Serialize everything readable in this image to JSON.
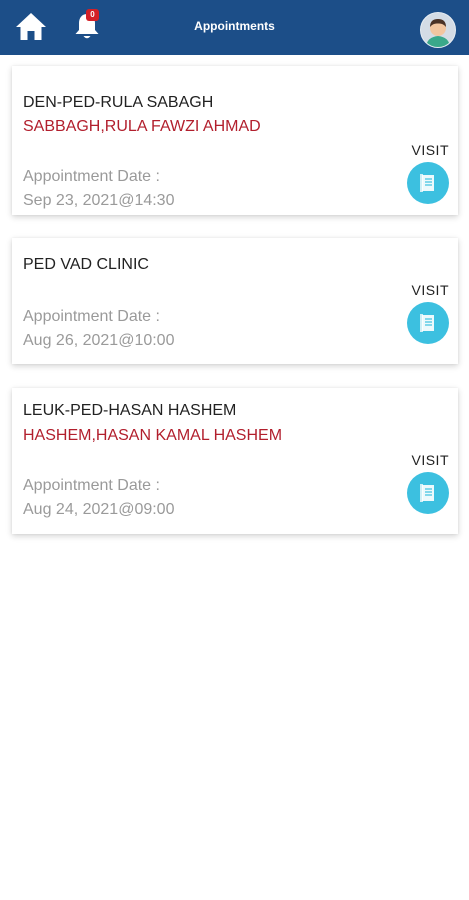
{
  "header": {
    "title": "Appointments",
    "notification_count": "0",
    "bar_color": "#1c4e88",
    "home_icon": "home-icon",
    "bell_icon": "bell-icon",
    "avatar_icon": "user-avatar"
  },
  "appointments": [
    {
      "clinic": "DEN-PED-RULA SABAGH",
      "doctor": "SABBAGH,RULA FAWZI AHMAD",
      "date_label": "Appointment Date :",
      "date": "Sep 23, 2021@14:30",
      "visit_label": "VISIT"
    },
    {
      "clinic": "PED VAD CLINIC",
      "doctor": "",
      "date_label": "Appointment Date :",
      "date": "Aug 26, 2021@10:00",
      "visit_label": "VISIT"
    },
    {
      "clinic": "LEUK-PED-HASAN HASHEM",
      "doctor": "HASHEM,HASAN KAMAL HASHEM",
      "date_label": "Appointment Date :",
      "date": "Aug 24, 2021@09:00",
      "visit_label": "VISIT"
    }
  ],
  "colors": {
    "doctor_text": "#b21f2d",
    "visit_button": "#3cc0e0"
  }
}
